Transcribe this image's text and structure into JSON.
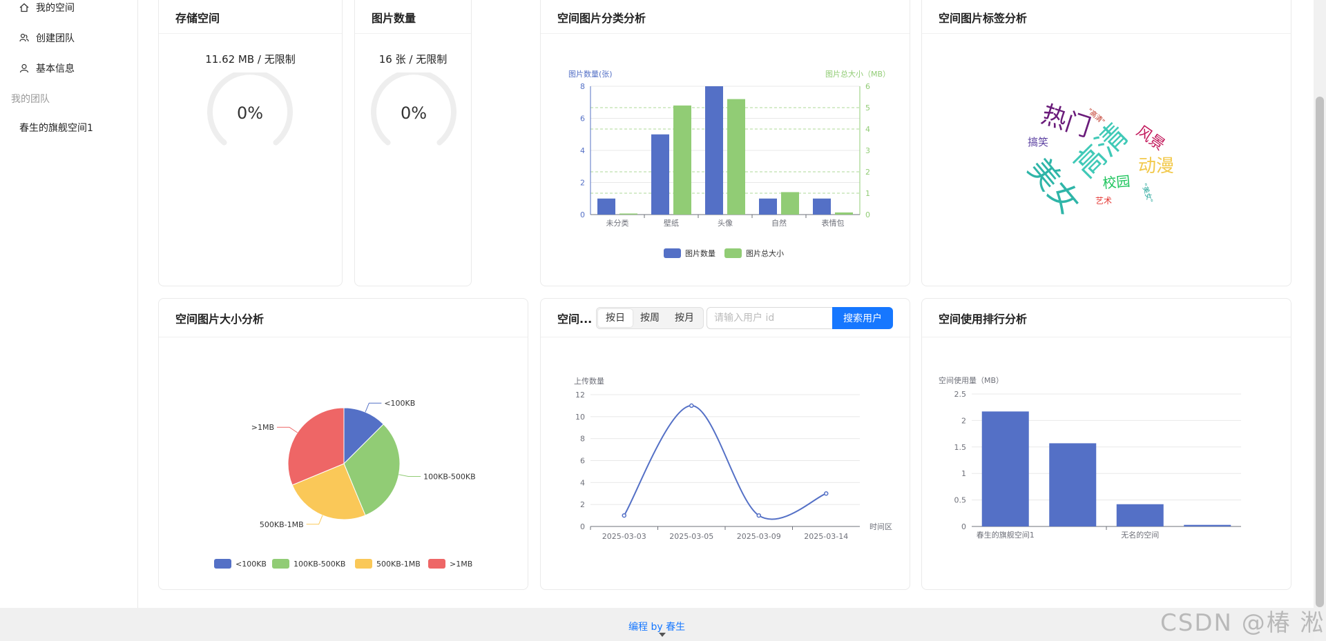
{
  "sidebar": {
    "items": [
      {
        "label": "我的空间",
        "icon": "home-icon"
      },
      {
        "label": "创建团队",
        "icon": "team-icon"
      },
      {
        "label": "基本信息",
        "icon": "user-icon"
      }
    ],
    "group_title": "我的团队",
    "team_items": [
      {
        "label": "春生的旗舰空间1"
      }
    ],
    "collapse_label": "<"
  },
  "cards": {
    "storage": {
      "title": "存储空间",
      "value": "11.62 MB / 无限制",
      "percent_label": "0%",
      "percent": 0
    },
    "count": {
      "title": "图片数量",
      "value": "16 张 / 无限制",
      "percent_label": "0%",
      "percent": 0
    },
    "category": {
      "title": "空间图片分类分析"
    },
    "tags": {
      "title": "空间图片标签分析"
    },
    "size": {
      "title": "空间图片大小分析"
    },
    "user": {
      "title": "空间...",
      "segments": [
        "按日",
        "按周",
        "按月"
      ],
      "active_segment": "按日",
      "search_placeholder": "请输入用户 id",
      "search_button": "搜索用户"
    },
    "rank": {
      "title": "空间使用排行分析"
    }
  },
  "chart_data": [
    {
      "type": "bar",
      "categories": [
        "未分类",
        "壁纸",
        "头像",
        "自然",
        "表情包"
      ],
      "series": [
        {
          "name": "图片数量",
          "values": [
            1,
            5,
            8,
            1,
            1
          ]
        },
        {
          "name": "图片总大小",
          "values": [
            0.05,
            5.1,
            5.4,
            1.05,
            0.1
          ]
        }
      ],
      "ylabel_left": "图片数量(张)",
      "ylabel_right": "图片总大小（MB）",
      "ylim_left": [
        0,
        8
      ],
      "ylim_right": [
        0,
        6
      ],
      "yticks_left": [
        "0",
        "2",
        "4",
        "6",
        "8"
      ],
      "yticks_right": [
        "0",
        "1",
        "2",
        "3",
        "4",
        "5",
        "6"
      ],
      "legend": "bottom",
      "colors": [
        "#5470c6",
        "#91cc75"
      ]
    },
    {
      "type": "wordcloud",
      "words": [
        {
          "text": "热门",
          "color": "#6a1b7a"
        },
        {
          "text": "高清",
          "color": "#40c9b7"
        },
        {
          "text": "美女",
          "color": "#2fb5a8"
        },
        {
          "text": "风景",
          "color": "#c2185b"
        },
        {
          "text": "动漫",
          "color": "#f2c94c"
        },
        {
          "text": "校园",
          "color": "#1dc45c"
        },
        {
          "text": "搞笑",
          "color": "#5a3fa0"
        },
        {
          "text": "\"高清\"",
          "color": "#c0392b"
        },
        {
          "text": "艺术",
          "color": "#e53935"
        },
        {
          "text": "\"美女\"",
          "color": "#26a69a"
        }
      ]
    },
    {
      "type": "pie",
      "labels": [
        "<100KB",
        "100KB-500KB",
        "500KB-1MB",
        ">1MB"
      ],
      "values": [
        2,
        5,
        4,
        5
      ],
      "colors": [
        "#5470c6",
        "#91cc75",
        "#fac858",
        "#ee6666"
      ],
      "legend": "bottom"
    },
    {
      "type": "line",
      "x": [
        "2025-03-03",
        "2025-03-05",
        "2025-03-09",
        "2025-03-14"
      ],
      "values": [
        1,
        11,
        1,
        3
      ],
      "ylabel": "上传数量",
      "xlabel": "时间区",
      "ylim": [
        0,
        12
      ],
      "yticks": [
        "0",
        "2",
        "4",
        "6",
        "8",
        "10",
        "12"
      ],
      "color": "#5470c6"
    },
    {
      "type": "bar",
      "categories": [
        "春生的旗舰空间1",
        "",
        "无名的空间",
        ""
      ],
      "values": [
        2.17,
        1.57,
        0.42,
        0.03
      ],
      "ylabel": "空间使用量（MB）",
      "ylim": [
        0,
        2.5
      ],
      "yticks": [
        "0",
        "0.5",
        "1",
        "1.5",
        "2",
        "2.5"
      ],
      "color": "#5470c6"
    }
  ],
  "footer": {
    "text": "编程 by 春生"
  },
  "watermark": "CSDN @椿  淞"
}
